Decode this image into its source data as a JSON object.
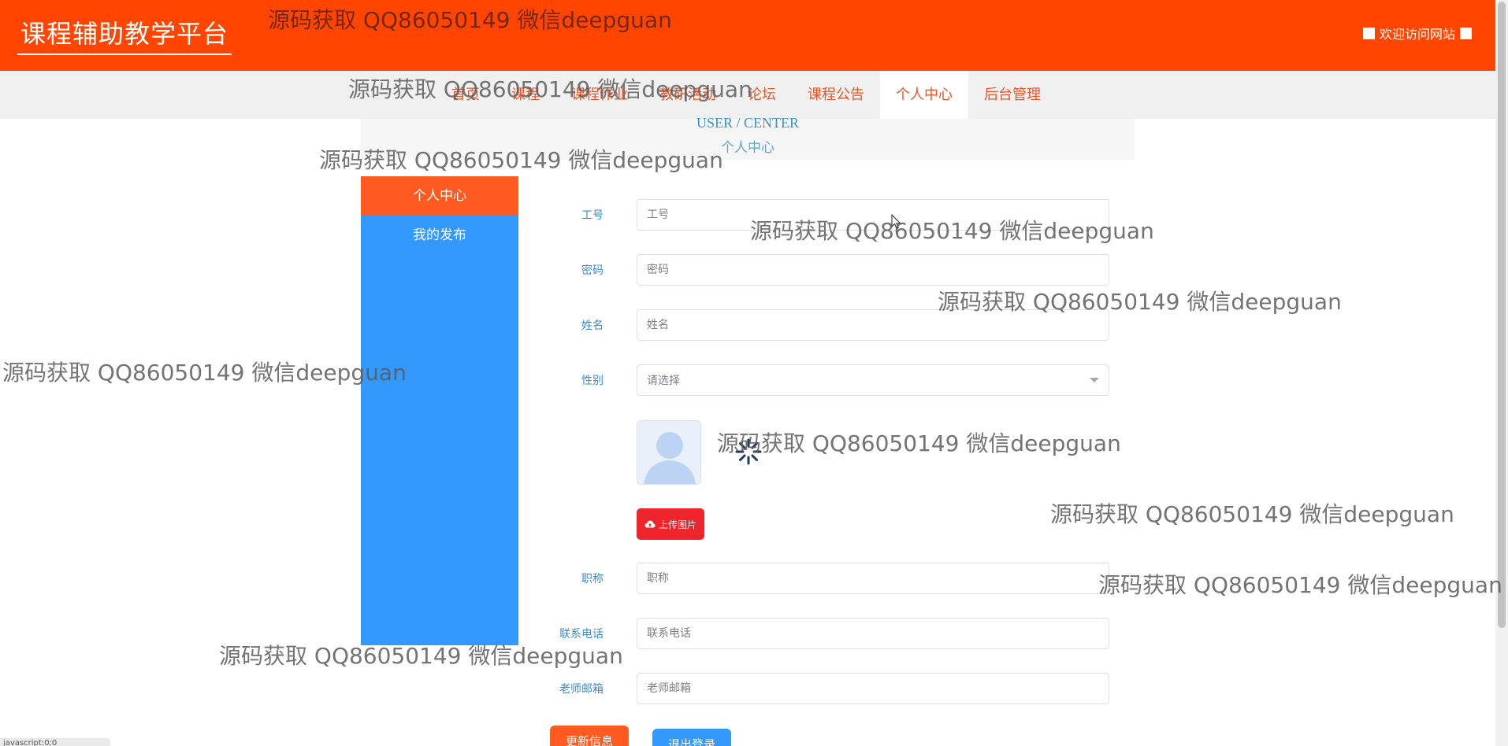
{
  "header": {
    "site_title": "课程辅助教学平台",
    "welcome_text": "欢迎访问网站"
  },
  "nav": {
    "items": [
      {
        "label": "首页"
      },
      {
        "label": "课程"
      },
      {
        "label": "课程作业"
      },
      {
        "label": "教研活动"
      },
      {
        "label": "论坛"
      },
      {
        "label": "课程公告"
      },
      {
        "label": "个人中心",
        "active": true
      },
      {
        "label": "后台管理"
      }
    ]
  },
  "breadcrumb": {
    "en": "USER / CENTER",
    "zh": "个人中心"
  },
  "sidebar": {
    "items": [
      {
        "label": "个人中心",
        "active": true
      },
      {
        "label": "我的发布"
      }
    ]
  },
  "form": {
    "id_label": "工号",
    "id_placeholder": "工号",
    "password_label": "密码",
    "password_placeholder": "密码",
    "name_label": "姓名",
    "name_placeholder": "姓名",
    "gender_label": "性别",
    "gender_placeholder": "请选择",
    "upload_label": "上传图片",
    "title_label": "职称",
    "title_placeholder": "职称",
    "phone_label": "联系电话",
    "phone_placeholder": "联系电话",
    "email_label": "老师邮箱",
    "email_placeholder": "老师邮箱"
  },
  "actions": {
    "update_label": "更新信息",
    "logout_label": "退出登录"
  },
  "status_bar": {
    "text": "javascript:0;0"
  },
  "watermark": {
    "text": "源码获取 QQ86050149 微信deepguan"
  },
  "colors": {
    "header_bg": "#ff4500",
    "nav_text": "#e8572a",
    "sidebar_bg": "#3399ff",
    "sidebar_active": "#ff5a1f",
    "label_blue": "#3a8cd0",
    "upload_red": "#f0242b"
  },
  "icons": {
    "upload": "cloud-upload-icon",
    "avatar": "user-avatar-icon",
    "loading": "loading-spinner-icon",
    "select_arrow": "chevron-down-icon"
  }
}
